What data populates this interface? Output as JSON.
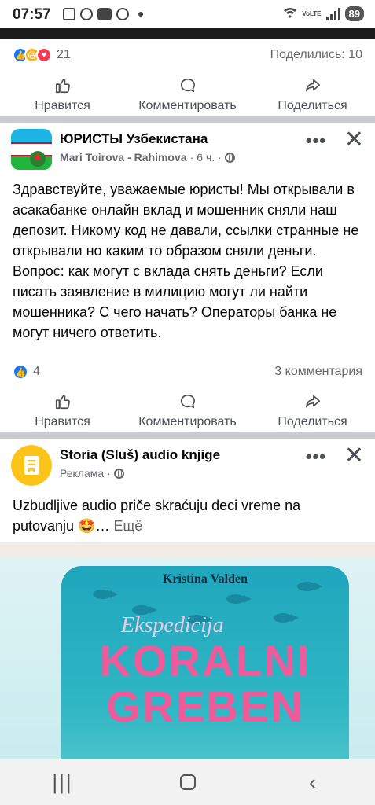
{
  "status_bar": {
    "time": "07:57",
    "icons": [
      "sim-icon",
      "message-icon",
      "youtube-icon",
      "instagram-icon"
    ],
    "wifi": "wifi-icon",
    "volte": "VoLTE",
    "battery": "89"
  },
  "post1": {
    "reactions": [
      "like",
      "haha",
      "love"
    ],
    "reaction_count": "21",
    "shares": "Поделились: 10"
  },
  "actions": {
    "like": "Нравится",
    "comment": "Комментировать",
    "share": "Поделиться"
  },
  "post2": {
    "group_name": "ЮРИСТЫ Узбекистана",
    "author": "Mari Toirova - Rahimova",
    "time": "6 ч.",
    "separator": "·",
    "text": "Здравствуйте, уважаемые юристы! Мы открывали в асакабанке онлайн вклад и мошенник сняли наш депозит. Никому код не давали, ссылки странные не открывали но каким то образом сняли деньги. Вопрос: как могут с вклада снять деньги? Если писать заявление в милицию могут ли найти мошенника? С чего начать? Операторы банка не могут ничего ответить.",
    "reaction_count": "4",
    "comments": "3 комментария"
  },
  "ad": {
    "page_name": "Storia (Sluš) audio knjige",
    "label": "Реклама",
    "separator": "·",
    "text": "Uzbudljive audio priče skraćuju deci vreme na putovanju 🤩… ",
    "more": "Ещё",
    "creative": {
      "author": "Kristina Valden",
      "subtitle": "Ekspedicija",
      "title_line1": "KORALNI",
      "title_line2": "GREBEN"
    }
  },
  "colors": {
    "facebook_blue": "#1877f2",
    "secondary_text": "#65676b",
    "divider": "#c9ccd1",
    "cover_teal": "#2fb7c4",
    "cover_title_pink": "#f05a9a"
  }
}
